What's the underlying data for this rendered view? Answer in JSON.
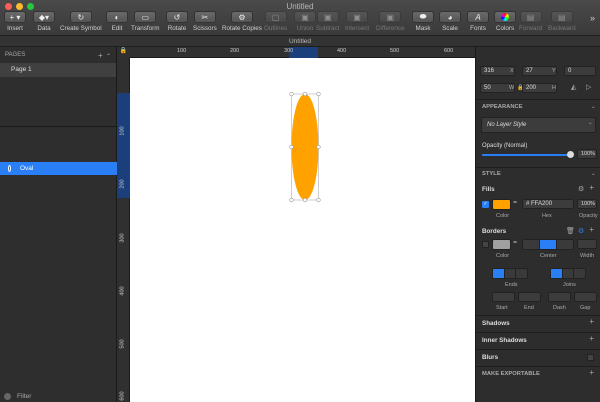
{
  "window": {
    "title": "Untitled",
    "tab": "Untitled"
  },
  "toolbar": {
    "insert": "Insert",
    "data": "Data",
    "create_symbol": "Create Symbol",
    "edit": "Edit",
    "transform": "Transform",
    "rotate": "Rotate",
    "scissors": "Scissors",
    "rotate_copies": "Rotate Copies",
    "outlines": "Outlines",
    "union": "Union",
    "subtract": "Subtract",
    "intersect": "Intersect",
    "difference": "Difference",
    "mask": "Mask",
    "scale": "Scale",
    "fonts": "Fonts",
    "colors": "Colors",
    "forward": "Forward",
    "backward": "Backward"
  },
  "pages": {
    "header": "PAGES",
    "items": [
      "Page 1"
    ]
  },
  "layers": {
    "items": [
      {
        "name": "Oval"
      }
    ]
  },
  "filter": {
    "label": "Filter"
  },
  "ruler": {
    "top": [
      "100",
      "200",
      "300",
      "400",
      "500",
      "600"
    ],
    "left": [
      "100",
      "200",
      "300",
      "400",
      "500",
      "600"
    ]
  },
  "inspector": {
    "x": "316",
    "y": "27",
    "rotation": "0",
    "width": "50",
    "height": "200",
    "appearance": "APPEARANCE",
    "layer_style": "No Layer Style",
    "opacity_label": "Opacity (Normal)",
    "opacity_value": "100%",
    "opacity_fraction": 1.0,
    "style": "STYLE",
    "fills": "Fills",
    "fill_hex": "FFA200",
    "fill_opacity": "100%",
    "fill_color": "#FFA200",
    "fill_labels": {
      "color": "Color",
      "hex": "Hex",
      "opacity": "Opacity"
    },
    "borders": "Borders",
    "border_labels": {
      "color": "Color",
      "center": "Center",
      "width": "Width"
    },
    "ends": "Ends",
    "joins": "Joins",
    "dash_labels": {
      "start": "Start",
      "end": "End",
      "dash": "Dash",
      "gap": "Gap"
    },
    "shadows": "Shadows",
    "inner_shadows": "Inner Shadows",
    "blurs": "Blurs",
    "export": "MAKE EXPORTABLE"
  },
  "colors": {
    "accent": "#2A7FF6",
    "fill": "#FFA200"
  }
}
